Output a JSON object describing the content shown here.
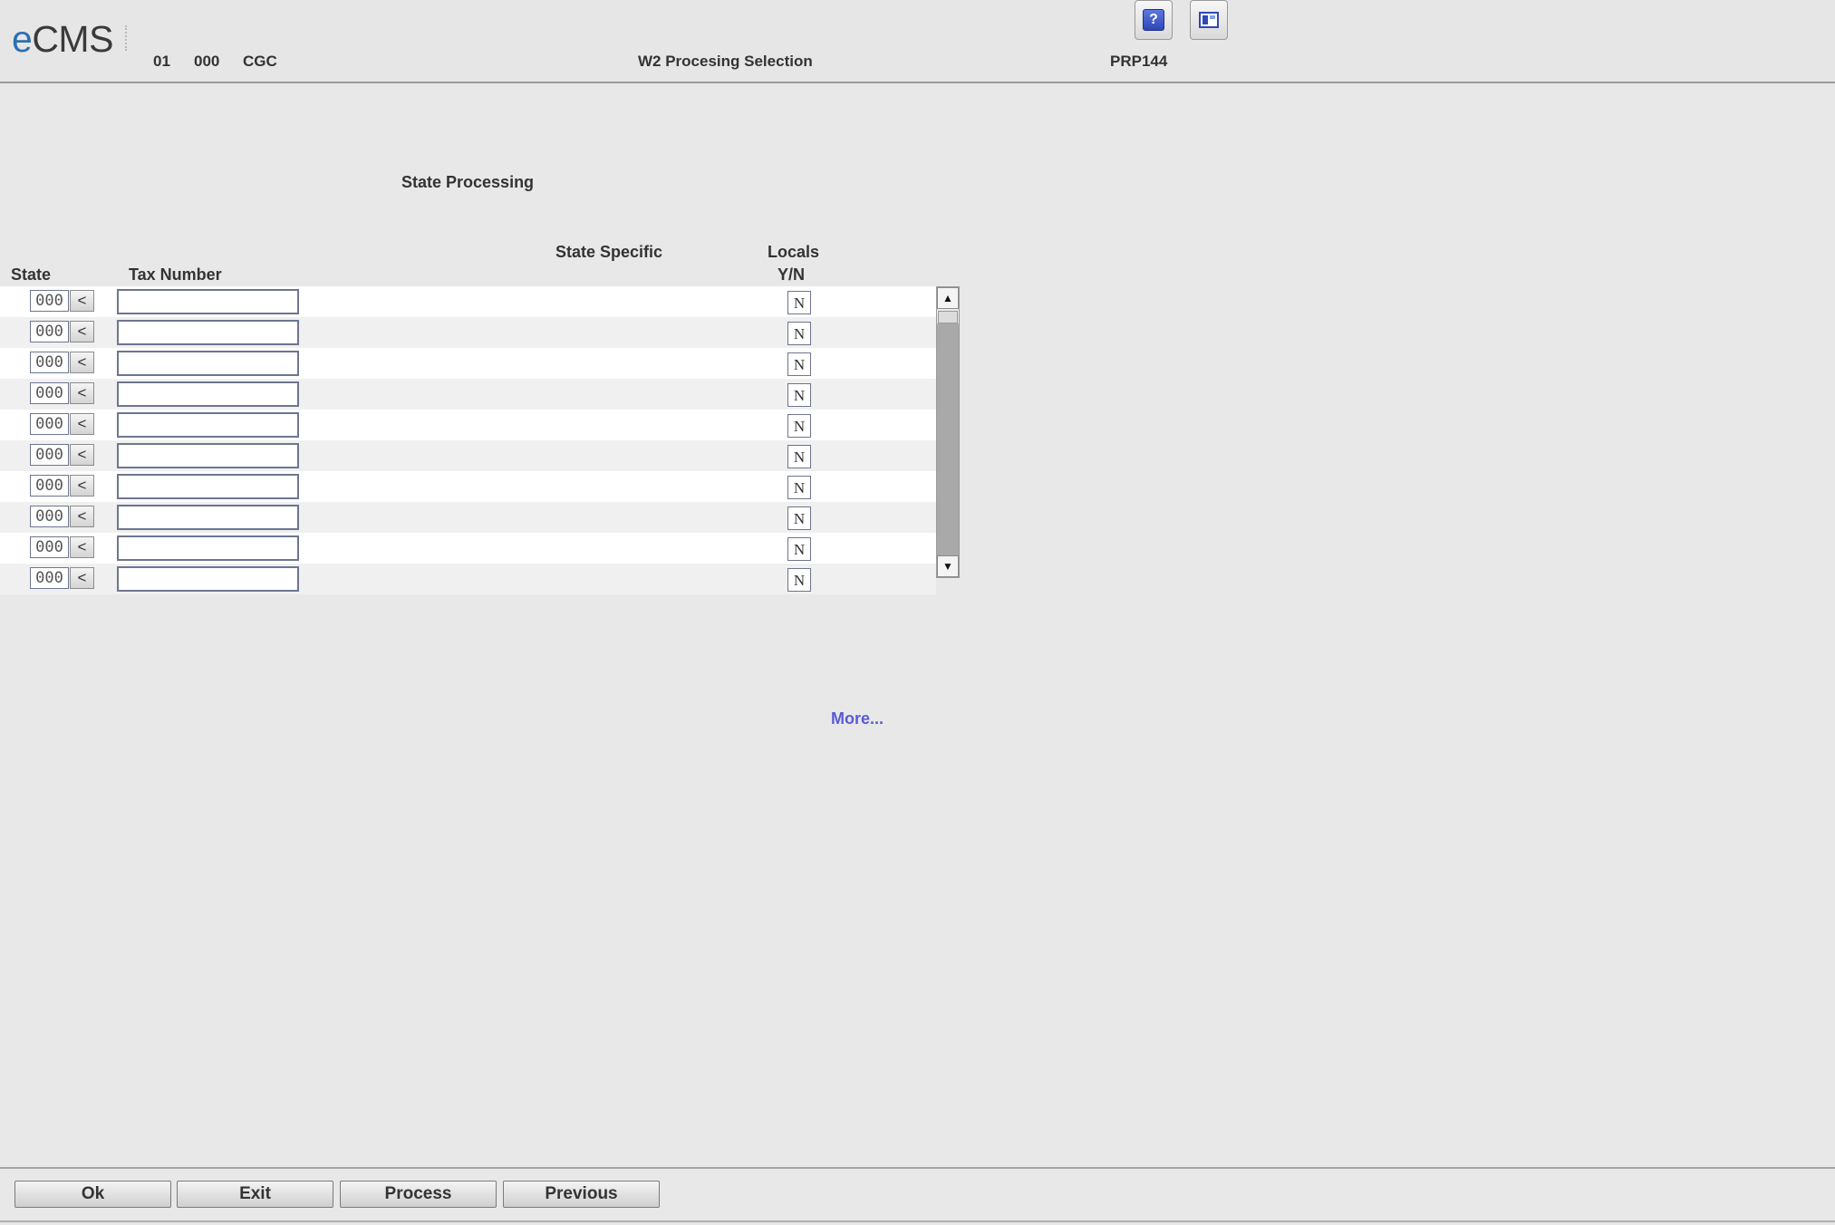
{
  "header": {
    "logo": {
      "e": "e",
      "rest": "CMS"
    },
    "company": "01",
    "division": "000",
    "app_code": "CGC",
    "title": "W2 Procesing Selection",
    "program_id": "PRP144",
    "help_icon": "question-mark-icon",
    "window_icon": "window-icon"
  },
  "section": {
    "heading": "State Processing",
    "columns": {
      "state": "State",
      "tax_number": "Tax Number",
      "state_specific": "State Specific",
      "locals_line1": "Locals",
      "locals_line2": "Y/N"
    }
  },
  "rows": [
    {
      "state": "000",
      "prompt": "<",
      "tax_number": "",
      "locals": "N"
    },
    {
      "state": "000",
      "prompt": "<",
      "tax_number": "",
      "locals": "N"
    },
    {
      "state": "000",
      "prompt": "<",
      "tax_number": "",
      "locals": "N"
    },
    {
      "state": "000",
      "prompt": "<",
      "tax_number": "",
      "locals": "N"
    },
    {
      "state": "000",
      "prompt": "<",
      "tax_number": "",
      "locals": "N"
    },
    {
      "state": "000",
      "prompt": "<",
      "tax_number": "",
      "locals": "N"
    },
    {
      "state": "000",
      "prompt": "<",
      "tax_number": "",
      "locals": "N"
    },
    {
      "state": "000",
      "prompt": "<",
      "tax_number": "",
      "locals": "N"
    },
    {
      "state": "000",
      "prompt": "<",
      "tax_number": "",
      "locals": "N"
    },
    {
      "state": "000",
      "prompt": "<",
      "tax_number": "",
      "locals": "N"
    }
  ],
  "scrollbar": {
    "up": "▲",
    "down": "▼"
  },
  "more_link": "More...",
  "footer": {
    "buttons": [
      "Ok",
      "Exit",
      "Process",
      "Previous"
    ]
  },
  "colors": {
    "logo_accent": "#2c6fb3",
    "link": "#5a5ad6"
  }
}
